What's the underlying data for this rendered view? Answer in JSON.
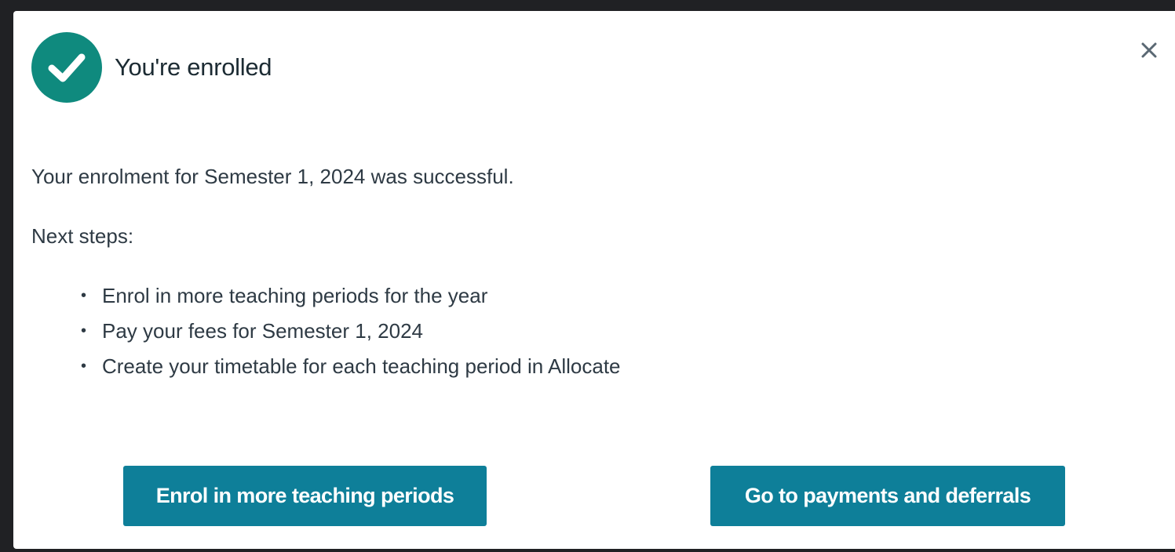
{
  "colors": {
    "success": "#0f8a7e",
    "primary_button": "#0e7f99",
    "text": "#2e3a44"
  },
  "dialog": {
    "title": "You're enrolled",
    "success_icon": "checkmark-circle-icon",
    "close_icon": "close-icon",
    "message": "Your enrolment for Semester 1, 2024 was successful.",
    "next_steps_label": "Next steps:",
    "next_steps": [
      "Enrol in more teaching periods for the year",
      "Pay your fees for Semester 1, 2024",
      "Create your timetable for each teaching period in Allocate"
    ],
    "buttons": {
      "enrol_more": "Enrol in more teaching periods",
      "payments": "Go to payments and deferrals"
    }
  }
}
